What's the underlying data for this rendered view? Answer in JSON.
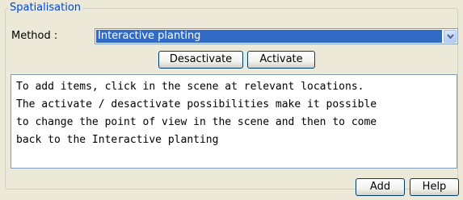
{
  "group": {
    "title": "Spatialisation"
  },
  "method": {
    "label": "Method :",
    "selected": "Interactive planting",
    "dropdown_icon": "chevron-down-icon"
  },
  "buttons": {
    "desactivate": "Desactivate",
    "activate": "Activate",
    "add": "Add",
    "help": "Help"
  },
  "info_text": "To add items, click in the scene at relevant locations.\nThe activate / desactivate possibilities make it possible\nto change the point of view in the scene and then to come\nback to the Interactive planting",
  "colors": {
    "background": "#ece9d8",
    "group_title": "#0046d5",
    "selection": "#316ac5"
  }
}
